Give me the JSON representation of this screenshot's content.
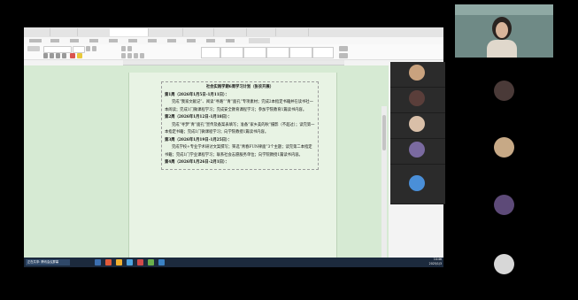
{
  "taskbar": {
    "active_item": "正在共享: 腾讯会议屏幕",
    "time": "14:46",
    "date": "2025/1/3"
  },
  "doc": {
    "title": "社会实践学期6周学习计划（张农开展）",
    "paragraphs": [
      {
        "text": "第1周（2026年1月5日-1月11日）：",
        "bold": true
      },
      {
        "text": "完成“我家文献记”、阅读“寻路”“青”面孔”专项素材；完成2本指定书籍并在读书社一本阅读；完成1门微课程学习；完成安全教育课程学习；参加学院教育1篇读书内容。",
        "bold": false
      },
      {
        "text": "第2周（2026年1月12日-1月18日）：",
        "bold": true
      },
      {
        "text": "完成“寻梦”青”面孔”宣传及备案表填写；准备“家乡美的秋”摄影（不超过）；读完第一本指定书籍；完成1门微课程学习；向学院教授1篇读书内容。",
        "bold": false
      },
      {
        "text": "第3周（2026年1月19日-1月25日）：",
        "bold": true
      },
      {
        "text": "完成学校+专业学术研讨文案撰写；筛选“青春FUN律面”3个主题；读完第二本指定书籍；完成1门学业课程学习；联系社会志愿服务单位；向学院教授1篇读书内容。",
        "bold": false
      },
      {
        "text": "第4周（2026年1月26日-2月1日）：",
        "bold": true
      }
    ]
  }
}
